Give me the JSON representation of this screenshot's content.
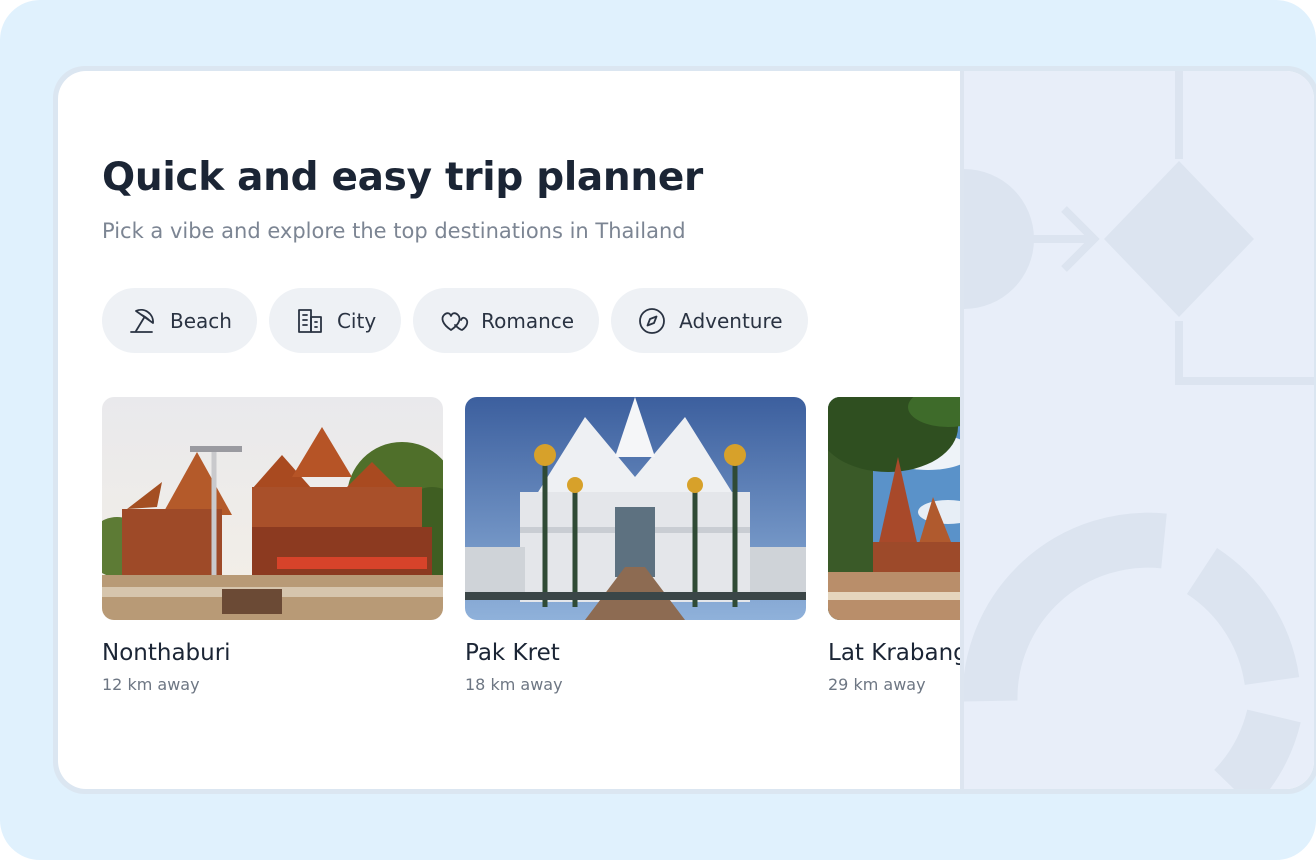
{
  "header": {
    "title": "Quick and easy trip planner",
    "subtitle": "Pick a vibe and explore the top destinations in Thailand"
  },
  "vibes": [
    {
      "label": "Beach",
      "icon": "beach-umbrella-icon"
    },
    {
      "label": "City",
      "icon": "city-buildings-icon"
    },
    {
      "label": "Romance",
      "icon": "hearts-icon"
    },
    {
      "label": "Adventure",
      "icon": "compass-icon"
    }
  ],
  "destinations": [
    {
      "name": "Nonthaburi",
      "distance": "12 km away"
    },
    {
      "name": "Pak Kret",
      "distance": "18 km away"
    },
    {
      "name": "Lat Krabang",
      "distance": "29 km away"
    }
  ],
  "colors": {
    "background": "#e0f1fd",
    "card": "#ffffff",
    "chip": "#eef1f5",
    "title": "#1b2535",
    "muted": "#7c8593",
    "pattern": "#e8eef9",
    "pattern_shape": "#dce4f0"
  }
}
